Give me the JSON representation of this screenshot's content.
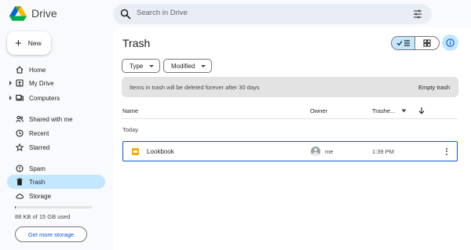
{
  "app": {
    "name": "Drive"
  },
  "search": {
    "placeholder": "Search in Drive"
  },
  "new_button": {
    "label": "New"
  },
  "sidebar": {
    "items": [
      {
        "label": "Home",
        "icon": "home-icon"
      },
      {
        "label": "My Drive",
        "icon": "my-drive-icon",
        "expandable": true
      },
      {
        "label": "Computers",
        "icon": "computers-icon",
        "expandable": true
      },
      {
        "label": "Shared with me",
        "icon": "shared-icon"
      },
      {
        "label": "Recent",
        "icon": "clock-icon"
      },
      {
        "label": "Starred",
        "icon": "star-icon"
      },
      {
        "label": "Spam",
        "icon": "spam-icon"
      },
      {
        "label": "Trash",
        "icon": "trash-icon",
        "active": true
      },
      {
        "label": "Storage",
        "icon": "cloud-icon"
      }
    ]
  },
  "storage": {
    "used_text": "88 KB of 15 GB used",
    "used_fraction": 0.01,
    "cta": "Get more storage"
  },
  "main": {
    "title": "Trash",
    "filters": [
      "Type",
      "Modified"
    ],
    "banner": {
      "text": "Items in trash will be deleted forever after 30 days",
      "action": "Empty trash"
    },
    "columns": {
      "name": "Name",
      "owner": "Owner",
      "trashed": "Trashe..."
    },
    "group": "Today",
    "files": [
      {
        "name": "Lookbook",
        "owner": "me",
        "trashed": "1:39 PM"
      }
    ]
  },
  "colors": {
    "accent": "#0b57d0",
    "selected_bg": "#c2e7ff",
    "surface": "#f8fafd"
  }
}
